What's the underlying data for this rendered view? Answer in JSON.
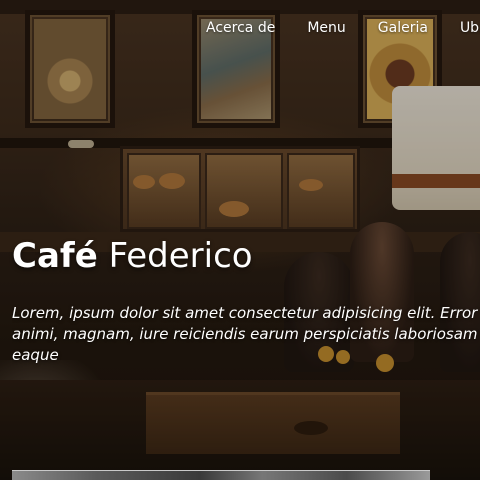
{
  "nav": {
    "items": [
      {
        "label": "Acerca de"
      },
      {
        "label": "Menu"
      },
      {
        "label": "Galeria"
      },
      {
        "label": "Ubicación"
      }
    ]
  },
  "hero": {
    "title_strong": "Café",
    "title_light": "Federico",
    "lead_lines": [
      "Lorem, ipsum dolor sit amet consectetur adipisicing elit. Error",
      "animi, magnam, iure reiciendis earum perspiciatis laboriosam",
      "eaque"
    ]
  }
}
